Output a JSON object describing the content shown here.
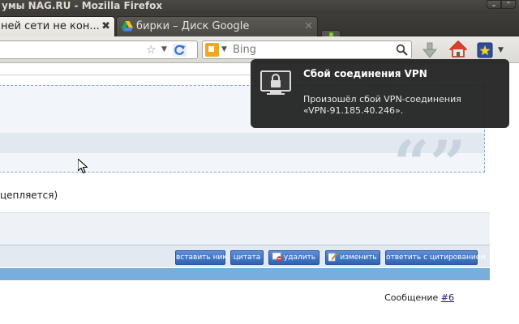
{
  "window": {
    "title": "умы NAG.RU - Mozilla Firefox",
    "buttons": [
      "⌄",
      "⌃"
    ]
  },
  "tabs": [
    {
      "label": "ней сети не кон...",
      "active": true,
      "close": "✖"
    },
    {
      "label": "бирки – Диск Google",
      "active": false,
      "close": "✕",
      "icon": "google-drive-icon"
    }
  ],
  "navbar": {
    "search_placeholder": "Bing",
    "search_engine_icon": "bing-icon",
    "icons": [
      "star-icon",
      "reload-icon",
      "magnifier-icon",
      "download-icon",
      "home-icon",
      "bookmark-icon"
    ]
  },
  "page": {
    "post_text": "цепляется)",
    "buttons": [
      {
        "label": "вставить ник"
      },
      {
        "label": "цитата"
      },
      {
        "label": "удалить",
        "icon": "delete-icon"
      },
      {
        "label": "изменить",
        "icon": "edit-icon"
      },
      {
        "label": "ответить с цитированием"
      }
    ],
    "message_label": "Сообщение",
    "message_link": "#6",
    "quote_glyph": "“”"
  },
  "notification": {
    "title": "Сбой соединения VPN",
    "body_line1": "Произошёл сбой VPN-соединения",
    "body_line2": "«VPN-91.185.40.246».",
    "icon": "lock-monitor-icon"
  },
  "colors": {
    "accent_button": "#2e62b5",
    "blue_band": "#78aeda",
    "notify_bg": "#1e1e1e"
  }
}
